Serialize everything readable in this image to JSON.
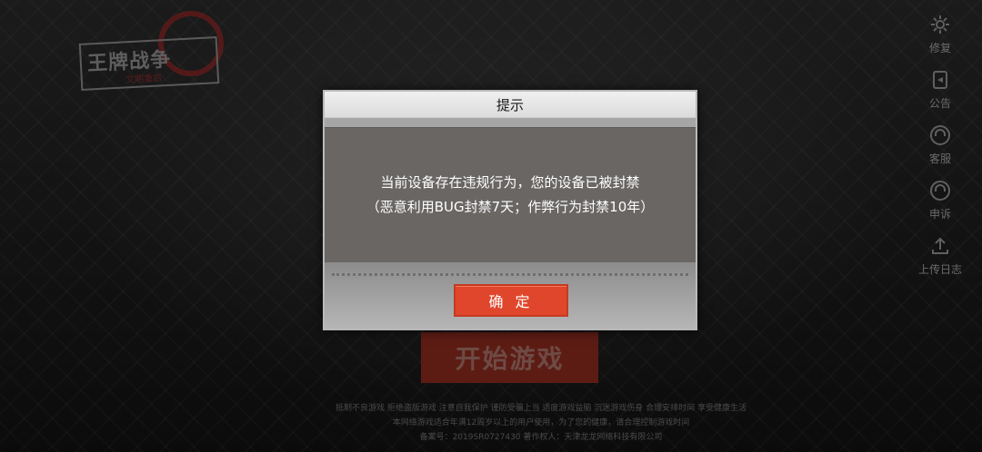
{
  "logo": {
    "title": "王牌战争",
    "subtitle": "文明重启"
  },
  "sidebar": {
    "items": [
      {
        "label": "修复",
        "icon": "gear-icon"
      },
      {
        "label": "公告",
        "icon": "notice-icon"
      },
      {
        "label": "客服",
        "icon": "headset-icon"
      },
      {
        "label": "申诉",
        "icon": "headset-icon"
      },
      {
        "label": "上传日志",
        "icon": "upload-icon"
      }
    ]
  },
  "start_button": {
    "label": "开始游戏"
  },
  "footer": {
    "line1": "抵制不良游戏 拒绝盗版游戏 注意自我保护 谨防受骗上当 适度游戏益脑 沉迷游戏伤身 合理安排时间 享受健康生活",
    "line2": "本网络游戏适合年满12周岁以上的用户使用，为了您的健康，请合理控制游戏时间",
    "line3": "备案号：2019SR0727430      著作权人：天津龙龙网络科技有限公司"
  },
  "dialog": {
    "title": "提示",
    "message_line1": "当前设备存在违规行为，您的设备已被封禁",
    "message_line2": "（恶意利用BUG封禁7天；作弊行为封禁10年）",
    "confirm_label": "确 定"
  },
  "colors": {
    "accent": "#e0462b",
    "dialog_bg": "#6b6966"
  }
}
